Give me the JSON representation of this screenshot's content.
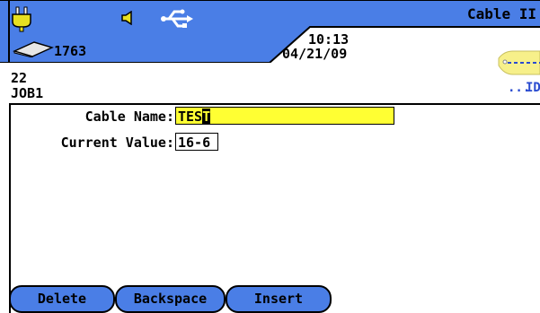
{
  "status_bar": {
    "title": "Cable II",
    "count": "1763",
    "time": "10:13",
    "date": "04/21/09",
    "icons": [
      "power-plug-icon",
      "speaker-icon",
      "usb-icon",
      "drive-icon",
      "id-tag-icon"
    ],
    "tag_text": "ID"
  },
  "info": {
    "line1": "22",
    "line2": "JOB1"
  },
  "form": {
    "cable_name_label": "Cable Name:",
    "cable_name_value": "TES",
    "cable_name_cursor_char": "T",
    "current_value_label": "Current Value:",
    "current_value_value": "16-6"
  },
  "softkeys": {
    "delete": "Delete",
    "backspace": "Backspace",
    "insert": "Insert"
  },
  "colors": {
    "accent_blue": "#4a7ee6",
    "field_highlight": "#ffff33"
  }
}
